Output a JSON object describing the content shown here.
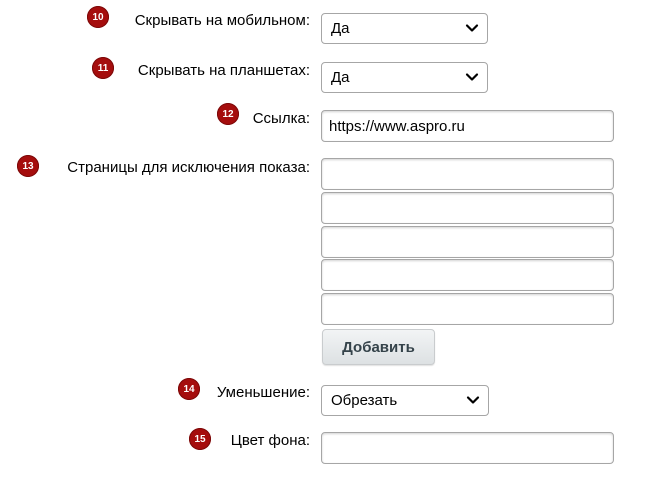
{
  "rows": [
    {
      "badge": "10",
      "label": "Скрывать на мобильном:",
      "value": "Да"
    },
    {
      "badge": "11",
      "label": "Скрывать на планшетах:",
      "value": "Да"
    },
    {
      "badge": "12",
      "label": "Ссылка:",
      "value": "https://www.aspro.ru"
    },
    {
      "badge": "13",
      "label": "Страницы для исключения показа:",
      "values": [
        "",
        "",
        "",
        "",
        ""
      ]
    },
    {
      "badge": "14",
      "label": "Уменьшение:",
      "value": "Обрезать"
    },
    {
      "badge": "15",
      "label": "Цвет фона:",
      "value": ""
    }
  ],
  "add_button_label": "Добавить",
  "icons": {
    "dropdown": "chevron-down-icon"
  },
  "colors": {
    "badge": "#a50d0d",
    "button_text": "#35434a"
  }
}
